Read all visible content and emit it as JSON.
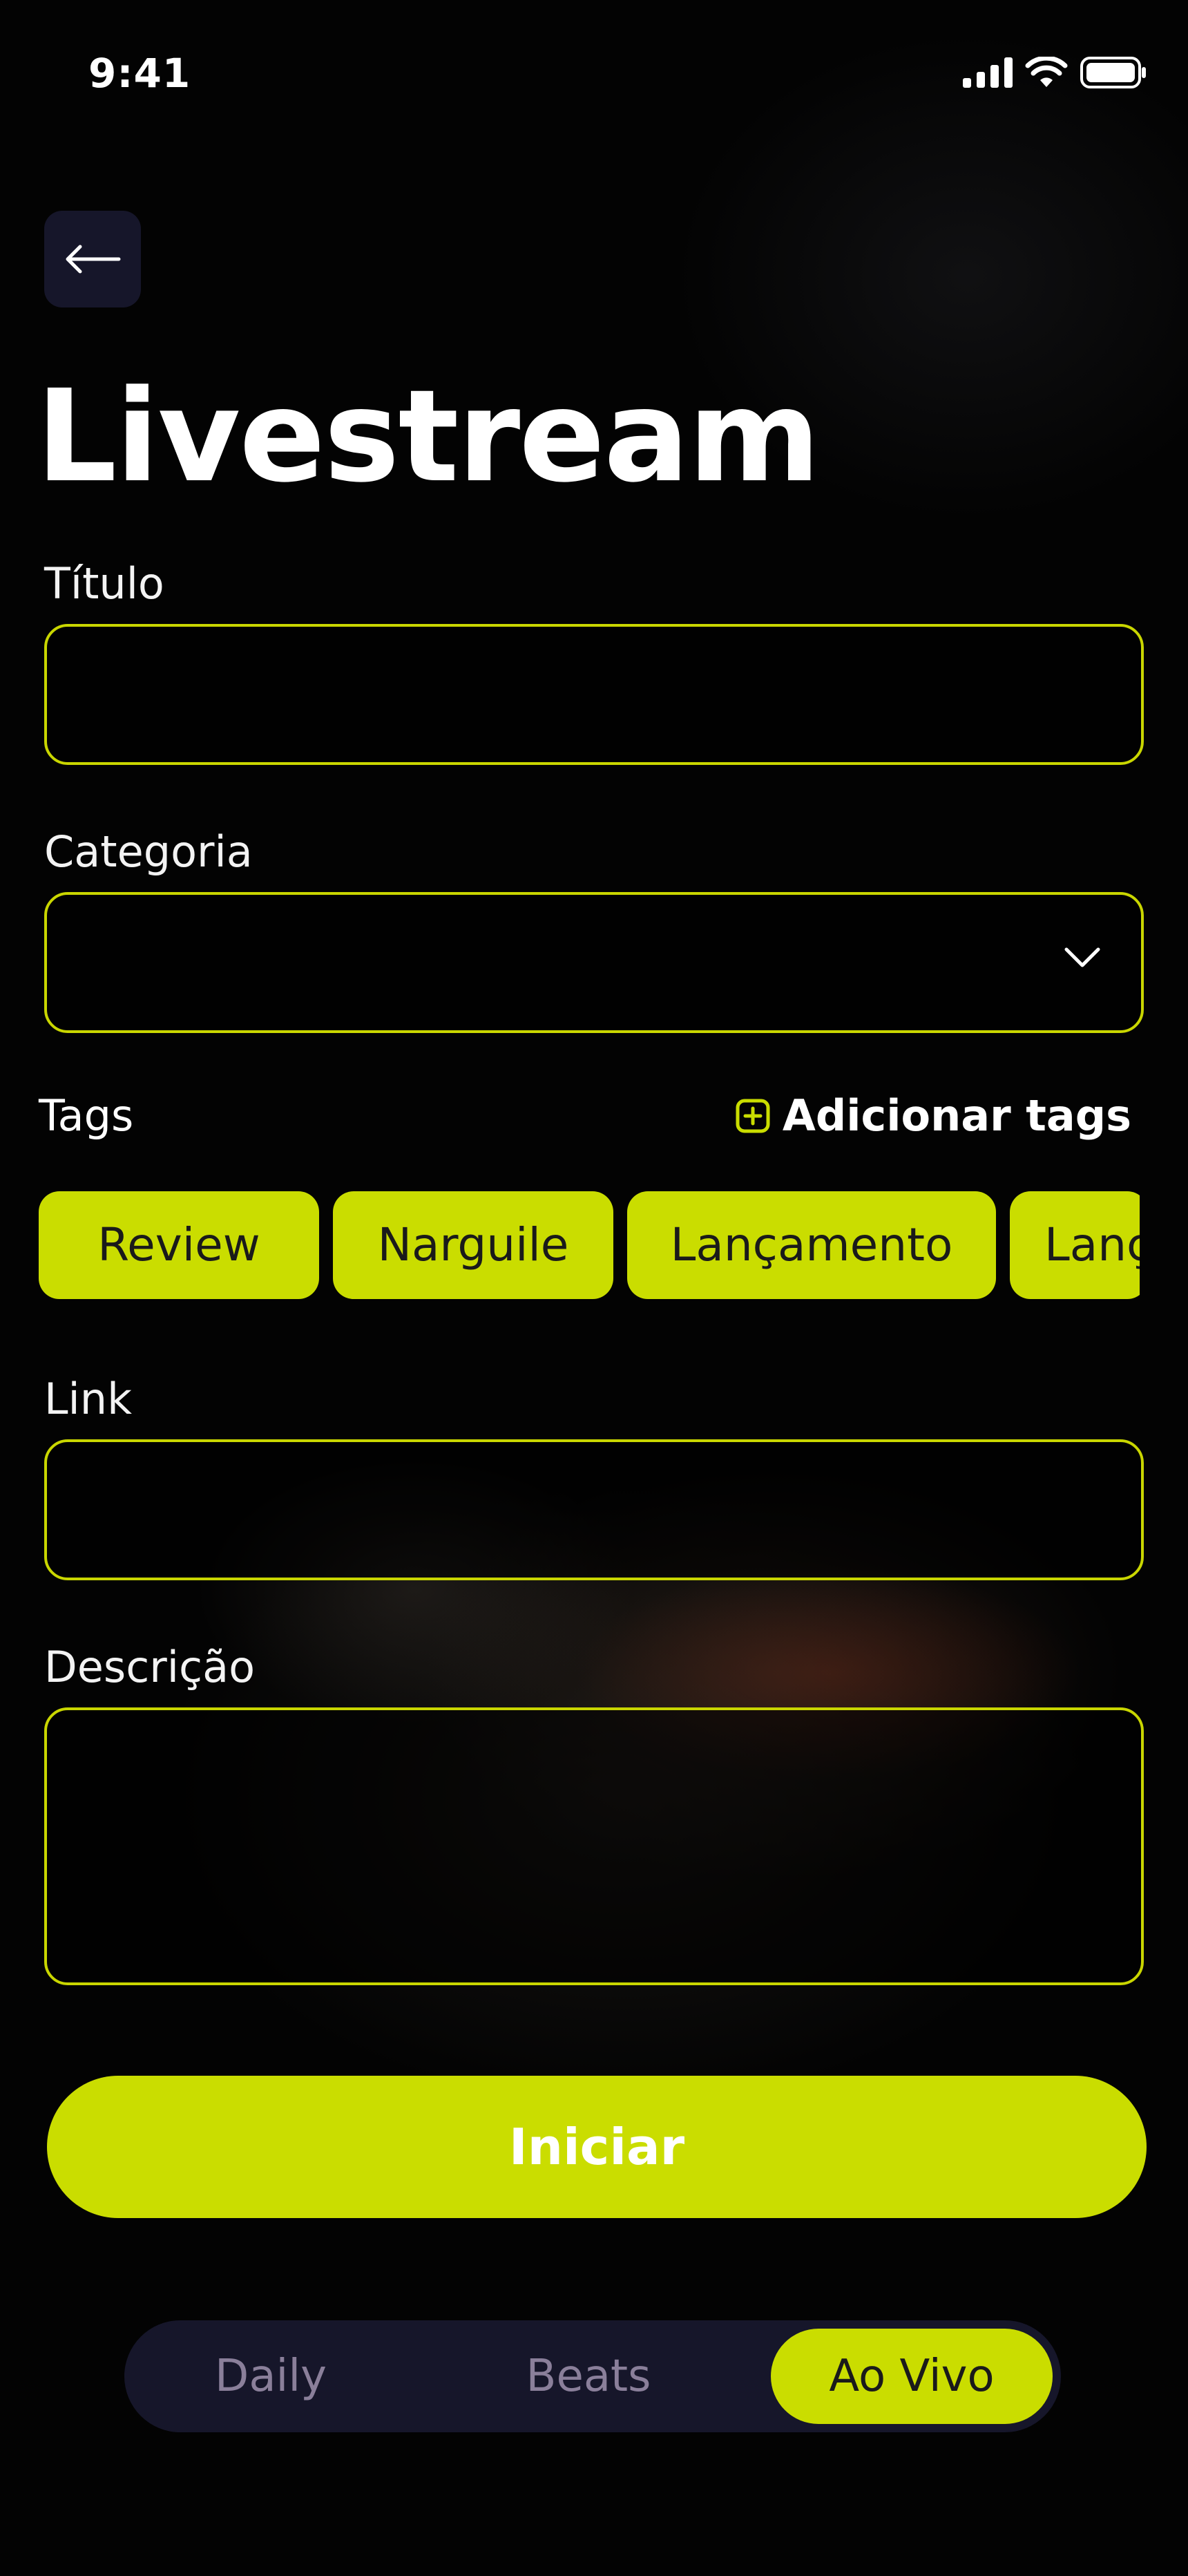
{
  "status_bar": {
    "time": "9:41"
  },
  "header": {
    "title": "Livestream"
  },
  "form": {
    "titulo": {
      "label": "Título",
      "value": ""
    },
    "categoria": {
      "label": "Categoria",
      "value": ""
    },
    "tags": {
      "label": "Tags",
      "add_label": "Adicionar tags",
      "items": [
        "Review",
        "Narguile",
        "Lançamento",
        "Lanç"
      ]
    },
    "link": {
      "label": "Link",
      "value": ""
    },
    "descricao": {
      "label": "Descrição",
      "value": ""
    }
  },
  "actions": {
    "start_label": "Iniciar"
  },
  "tab_bar": {
    "tabs": [
      "Daily",
      "Beats",
      "Ao Vivo"
    ],
    "active": "Ao Vivo"
  },
  "colors": {
    "accent": "#cadd00",
    "background": "#000000",
    "surface": "#16162a",
    "tab_inactive_text": "#8a7f9a"
  },
  "icons": {
    "back": "arrow-left-icon",
    "dropdown": "chevron-down-icon",
    "add": "plus-square-icon",
    "signal": "signal-icon",
    "wifi": "wifi-icon",
    "battery": "battery-icon"
  }
}
